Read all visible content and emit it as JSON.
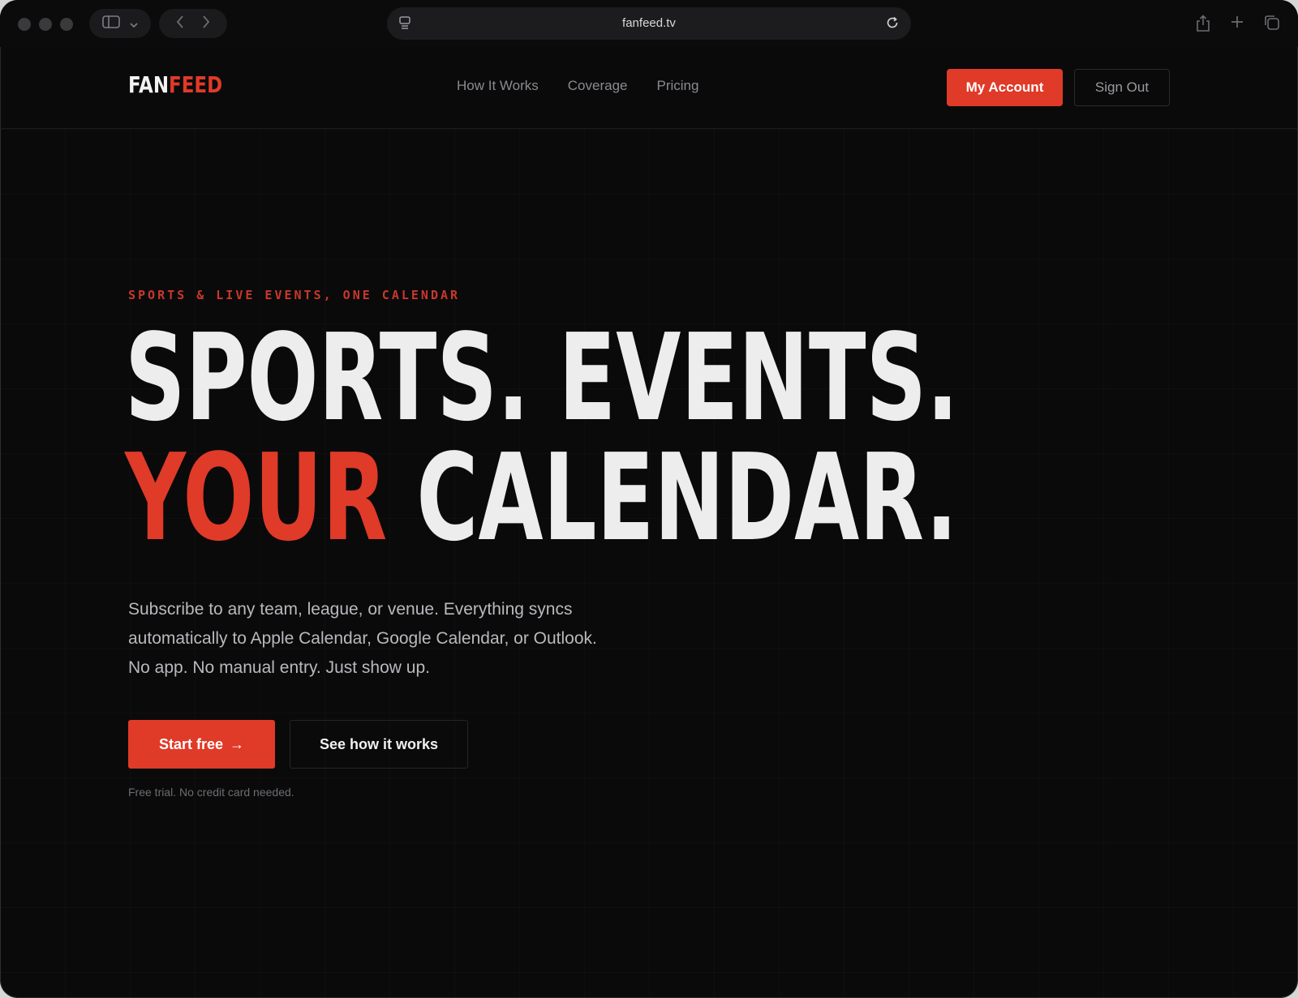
{
  "browser": {
    "url": "fanfeed.tv"
  },
  "header": {
    "logo_part1": "FAN",
    "logo_part2": "FEED",
    "nav": [
      "How It Works",
      "Coverage",
      "Pricing"
    ],
    "my_account_label": "My Account",
    "sign_out_label": "Sign Out"
  },
  "hero": {
    "eyebrow": "SPORTS & LIVE EVENTS, ONE CALENDAR",
    "headline_line1": "SPORTS. EVENTS.",
    "headline_accent": "YOUR",
    "headline_line2_rest": " CALENDAR.",
    "lede": "Subscribe to any team, league, or venue. Everything syncs automatically to Apple Calendar, Google Calendar, or Outlook. No app. No manual entry. Just show up.",
    "start_label": "Start free",
    "start_arrow": "→",
    "how_label": "See how it works",
    "fine_print": "Free trial. No credit card needed."
  },
  "colors": {
    "accent": "#e03a28",
    "background": "#0a0a0b",
    "text": "#ededed"
  }
}
